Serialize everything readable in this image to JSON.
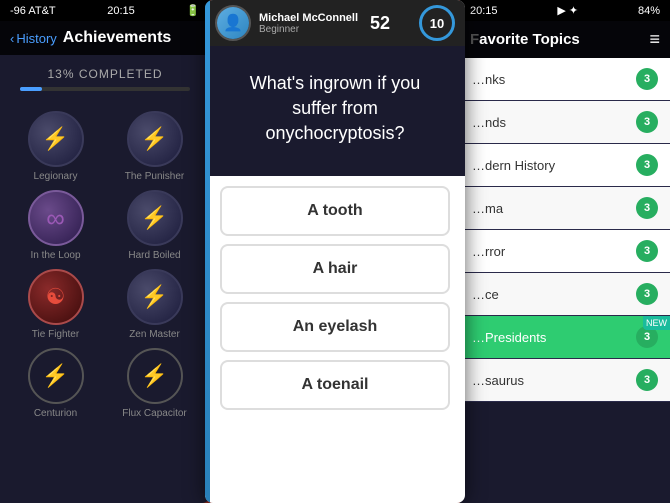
{
  "background": {
    "color": "#c0392b"
  },
  "left_panel": {
    "status_bar": {
      "signal": "-96 AT&T",
      "wifi": "WiFi",
      "time": "20:15",
      "battery": ""
    },
    "nav": {
      "back_label": "History",
      "title": "Achievements"
    },
    "progress": {
      "text": "13% COMPLETED",
      "value": 13
    },
    "achievements": [
      {
        "label": "Legionary",
        "type": "dark",
        "icon": "⚡"
      },
      {
        "label": "The Punisher",
        "type": "dark",
        "icon": "⚡"
      },
      {
        "label": "In the Loop",
        "type": "purple",
        "icon": "∞"
      },
      {
        "label": "Hard Boiled",
        "type": "dark",
        "icon": "⚡"
      },
      {
        "label": "Tie Fighter",
        "type": "red",
        "icon": "☯"
      },
      {
        "label": "Zen Master",
        "type": "dark",
        "icon": "⚡"
      },
      {
        "label": "Centurion",
        "type": "dark_outline",
        "icon": "⚡"
      },
      {
        "label": "Flux Capacitor",
        "type": "dark_outline",
        "icon": "⚡"
      }
    ]
  },
  "center_panel": {
    "user": {
      "name": "Michael McConnell",
      "level": "Beginner",
      "score": "52"
    },
    "score_badge": "10",
    "question": "What's ingrown if you suffer from onychocryptosis?",
    "answers": [
      {
        "label": "A tooth",
        "id": "answer-tooth"
      },
      {
        "label": "A hair",
        "id": "answer-hair"
      },
      {
        "label": "An eyelash",
        "id": "answer-eyelash"
      },
      {
        "label": "A toenail",
        "id": "answer-toenail"
      }
    ]
  },
  "right_panel": {
    "status_bar": {
      "time": "20:15",
      "battery": "84%"
    },
    "nav": {
      "title": "avorite Topics"
    },
    "topics": [
      {
        "name": "nks",
        "count": "3"
      },
      {
        "name": "nds",
        "count": "3"
      },
      {
        "name": "dern History",
        "count": "3"
      },
      {
        "name": "ma",
        "count": "3"
      },
      {
        "name": "rror",
        "count": "3"
      },
      {
        "name": "ce",
        "count": "3"
      },
      {
        "name": "Presidents",
        "count": "3",
        "highlighted": true
      },
      {
        "name": "saurus",
        "count": "3"
      }
    ]
  }
}
